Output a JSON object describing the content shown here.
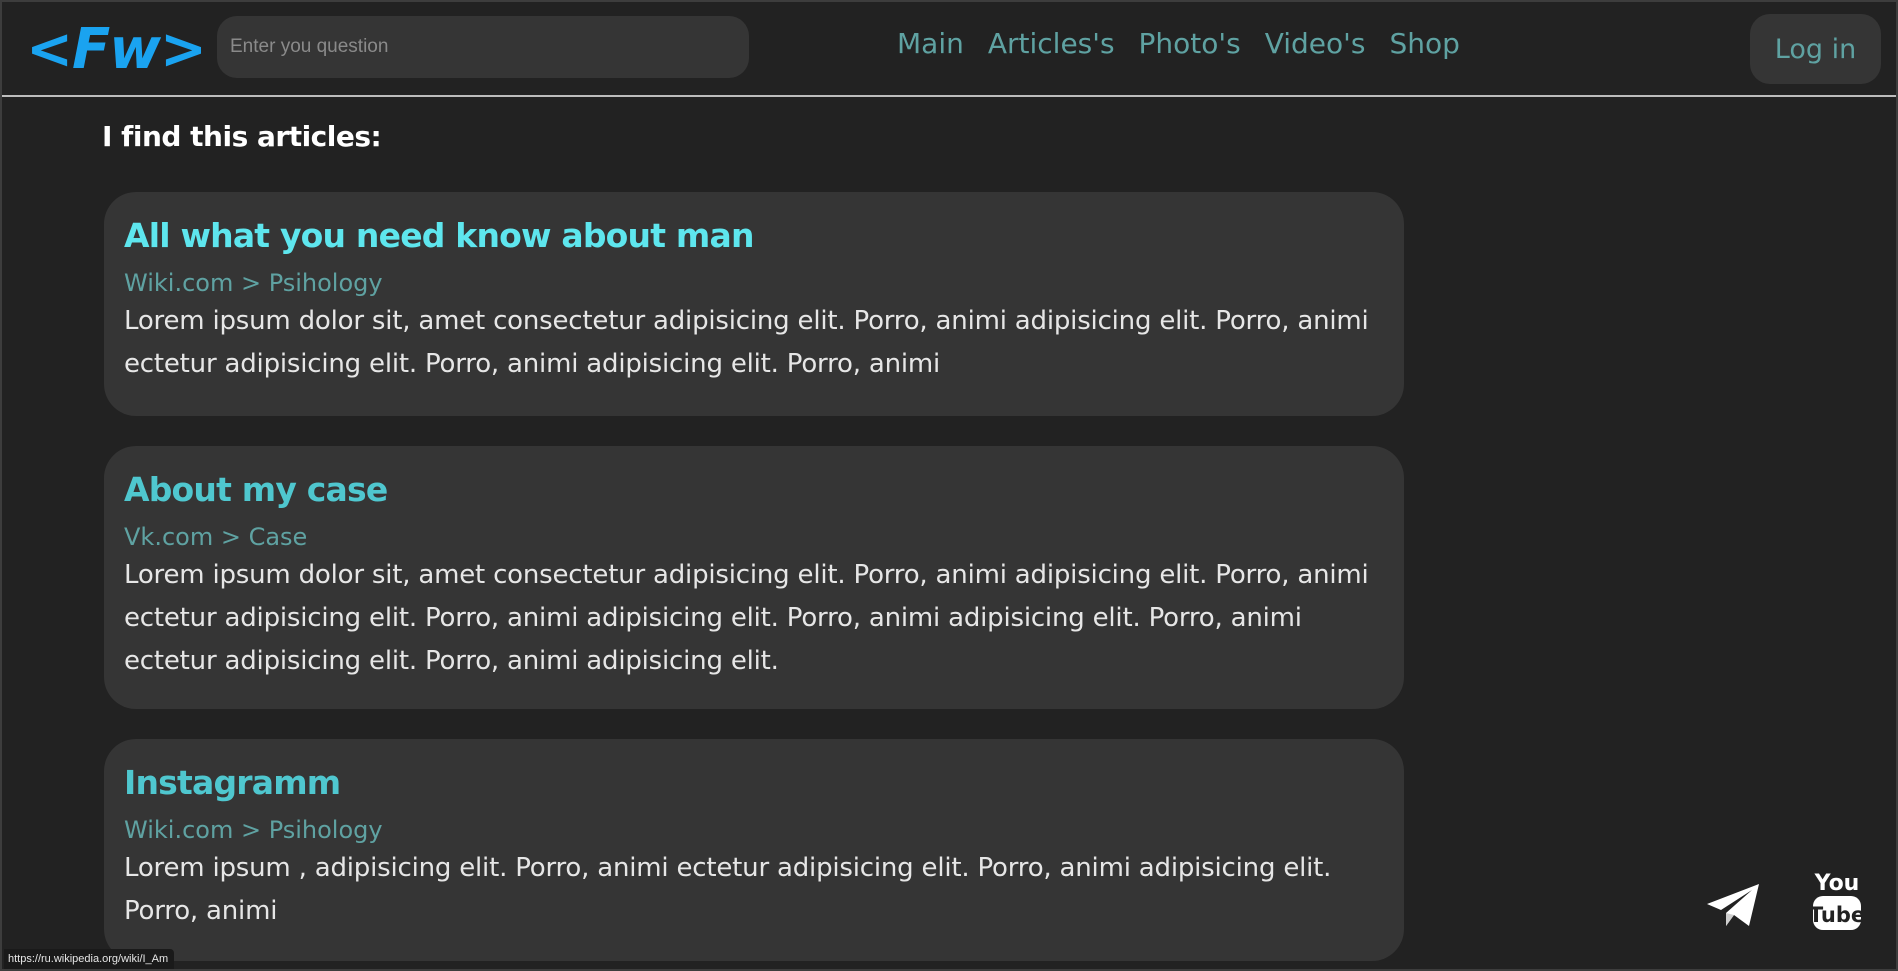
{
  "header": {
    "logo_text": "<Fw>",
    "search": {
      "placeholder": "Enter you question",
      "value": ""
    },
    "nav": [
      "Main",
      "Articles's",
      "Photo's",
      "Video's",
      "Shop"
    ],
    "login_label": "Log in"
  },
  "main": {
    "heading": "I find this articles:",
    "articles": [
      {
        "title": "All what you need know about man",
        "title_color": "#5ee6ee",
        "source": "Wiki.com > Psihology",
        "text": "Lorem ipsum dolor sit, amet consectetur adipisicing elit. Porro, animi adipisicing elit. Porro, animi ectetur adipisicing elit. Porro, animi adipisicing elit. Porro, animi"
      },
      {
        "title": "About my case",
        "title_color": "#4fc7cf",
        "source": "Vk.com > Case",
        "text": "Lorem ipsum dolor sit, amet consectetur adipisicing elit. Porro, animi adipisicing elit. Porro, animi ectetur adipisicing elit. Porro, animi adipisicing elit. Porro, animi adipisicing elit. Porro, animi ectetur adipisicing elit. Porro, animi adipisicing elit."
      },
      {
        "title": "Instagramm",
        "title_color": "#4fc7cf",
        "source": "Wiki.com > Psihology",
        "text": "Lorem ipsum , adipisicing elit. Porro, animi ectetur adipisicing elit. Porro, animi adipisicing elit. Porro, animi"
      }
    ]
  },
  "social": {
    "telegram_icon": "telegram-icon",
    "youtube_icon": "youtube-icon",
    "youtube_label_top": "You",
    "youtube_label_bottom": "Tube"
  },
  "status_bar": {
    "url": "https://ru.wikipedia.org/wiki/I_Am"
  },
  "colors": {
    "background": "#222222",
    "card": "#353535",
    "accent": "#5fa2a2",
    "logo": "#1aa3f0"
  }
}
